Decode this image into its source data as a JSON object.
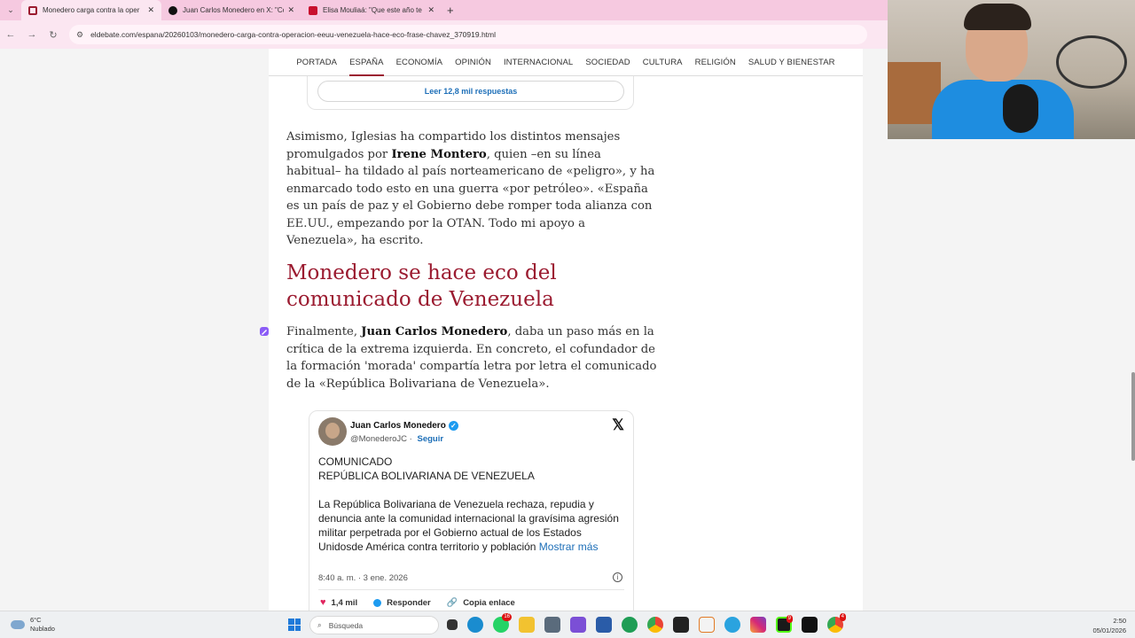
{
  "browser": {
    "tabs": [
      {
        "title": "Monedero carga contra la oper",
        "active": true,
        "favicon_color": "#9b1b30"
      },
      {
        "title": "Juan Carlos Monedero en X: \"Co",
        "active": false,
        "favicon_color": "#111111"
      },
      {
        "title": "Elisa Mouliaá: \"Que este año te",
        "active": false,
        "favicon_color": "#c8102e"
      }
    ],
    "url": "eldebate.com/espana/20260103/monedero-carga-contra-operacion-eeuu-venezuela-hace-eco-frase-chavez_370919.html"
  },
  "site_nav": [
    "PORTADA",
    "ESPAÑA",
    "ECONOMÍA",
    "OPINIÓN",
    "INTERNACIONAL",
    "SOCIEDAD",
    "CULTURA",
    "RELIGIÓN",
    "SALUD Y BIENESTAR"
  ],
  "site_nav_active": "ESPAÑA",
  "replies_button": "Leer 12,8 mil respuestas",
  "paragraph1": {
    "a": "Asimismo, Iglesias ha compartido los distintos mensajes promulgados por ",
    "bold": "Irene Montero",
    "b": ", quien –en su línea habitual– ha tildado al país norteamericano de «peligro», y ha enmarcado todo esto en una guerra «por petróleo». «España es un país de paz y el Gobierno debe romper toda alianza con EE.UU., empezando por la OTAN. Todo mi apoyo a Venezuela», ha escrito."
  },
  "heading": "Monedero se hace eco del comunicado de Venezuela",
  "paragraph2": {
    "a": "Finalmente, ",
    "bold": "Juan Carlos Monedero",
    "b": ", daba un paso más en la crítica de la extrema izquierda. En concreto, el cofundador de la formación 'morada' compartía letra por letra el comunicado de la «República Bolivariana de Venezuela»."
  },
  "tweet": {
    "name": "Juan Carlos Monedero",
    "handle": "@MonederoJC",
    "follow": "Seguir",
    "line1": "COMUNICADO",
    "line2": "REPÚBLICA BOLIVARIANA DE VENEZUELA",
    "body": "La República Bolivariana de Venezuela rechaza, repudia y denuncia ante la comunidad internacional la gravísima agresión militar perpetrada por el Gobierno actual de los Estados Unidosde América contra territorio y población ",
    "more": "Mostrar más",
    "time": "8:40 a. m. · 3 ene. 2026",
    "likes": "1,4 mil",
    "reply": "Responder",
    "copy": "Copia enlace"
  },
  "taskbar": {
    "temp": "6°C",
    "weather": "Nublado",
    "search_placeholder": "Búsqueda",
    "time": "2:50",
    "date": "05/01/2026",
    "badges": {
      "whatsapp": "16",
      "app_k": "9",
      "chrome": "4"
    }
  }
}
